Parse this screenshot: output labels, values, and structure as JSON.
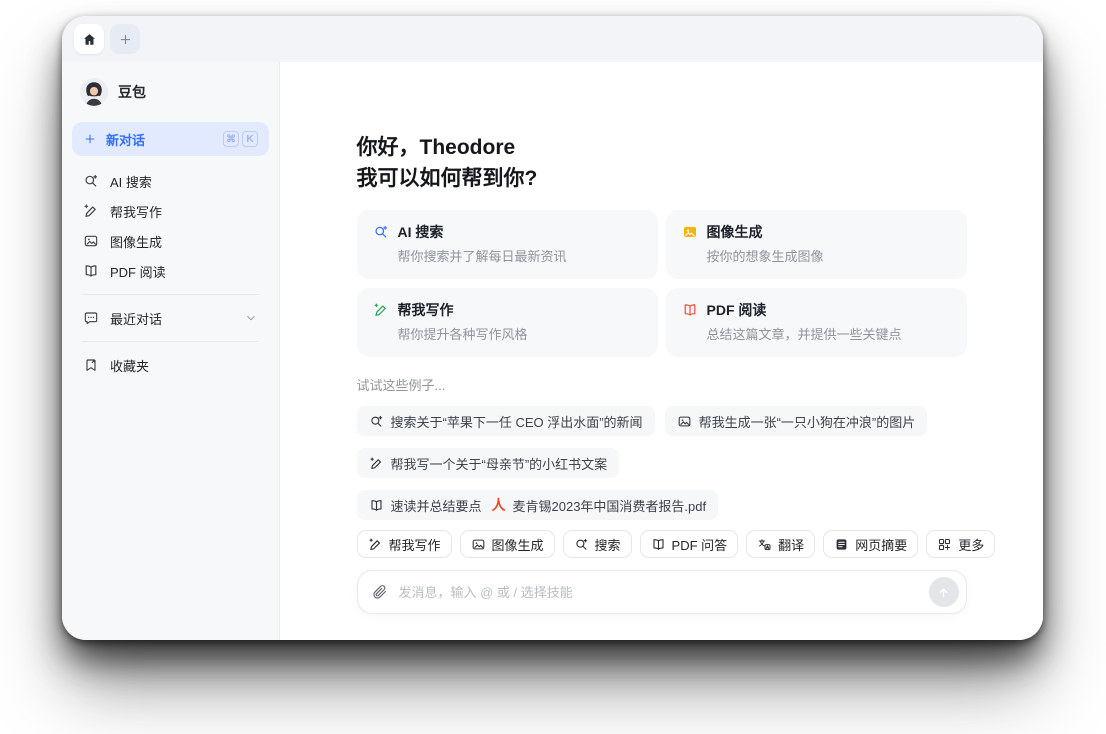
{
  "tabbar": {
    "tabs": [
      {
        "name": "home",
        "icon": "home-icon"
      },
      {
        "name": "new-tab",
        "icon": "plus-icon"
      }
    ]
  },
  "sidebar": {
    "profile": {
      "name": "豆包"
    },
    "new_chat": {
      "label": "新对话",
      "keys": [
        "⌘",
        "K"
      ]
    },
    "items": [
      {
        "icon": "ai-search-icon",
        "label": "AI 搜索"
      },
      {
        "icon": "writing-icon",
        "label": "帮我写作"
      },
      {
        "icon": "image-gen-icon",
        "label": "图像生成"
      },
      {
        "icon": "pdf-read-icon",
        "label": "PDF 阅读"
      }
    ],
    "recent": {
      "icon": "chat-bubble-icon",
      "label": "最近对话"
    },
    "favorites": {
      "icon": "bookmark-icon",
      "label": "收藏夹"
    }
  },
  "main": {
    "greeting_line1": "你好，Theodore",
    "greeting_line2": "我可以如何帮到你?",
    "feature_cards": [
      {
        "icon": "ai-search-icon",
        "color": "#3370ff",
        "title": "AI 搜索",
        "desc": "帮你搜索并了解每日最新资讯"
      },
      {
        "icon": "image-gen-icon",
        "color": "#f2b50f",
        "title": "图像生成",
        "desc": "按你的想象生成图像"
      },
      {
        "icon": "writing-icon",
        "color": "#2aa557",
        "title": "帮我写作",
        "desc": "帮你提升各种写作风格"
      },
      {
        "icon": "pdf-read-icon",
        "color": "#ee4f35",
        "title": "PDF 阅读",
        "desc": "总结这篇文章，并提供一些关键点"
      }
    ],
    "examples_label": "试试这些例子...",
    "example_chips": [
      {
        "icon": "search-icon",
        "text": "搜索关于“苹果下一任 CEO 浮出水面”的新闻"
      },
      {
        "icon": "image-icon",
        "text": "帮我生成一张“一只小狗在冲浪”的图片"
      },
      {
        "icon": "pen-icon",
        "text": "帮我写一个关于“母亲节”的小红书文案"
      },
      {
        "icon": "book-icon",
        "text": "速读并总结要点",
        "attachment": {
          "icon": "pdf-file-icon",
          "glyph": "人",
          "name": "麦肯锡2023年中国消费者报告.pdf"
        }
      }
    ],
    "skill_chips": [
      {
        "icon": "pen-icon",
        "label": "帮我写作"
      },
      {
        "icon": "image-icon",
        "label": "图像生成"
      },
      {
        "icon": "search-icon",
        "label": "搜索"
      },
      {
        "icon": "book-icon",
        "label": "PDF 问答"
      },
      {
        "icon": "translate-icon",
        "label": "翻译"
      },
      {
        "icon": "webpage-icon",
        "label": "网页摘要"
      },
      {
        "icon": "more-icon",
        "label": "更多"
      }
    ],
    "composer": {
      "placeholder": "发消息，输入 @ 或 / 选择技能"
    }
  },
  "colors": {
    "accent": "#3370ff",
    "new_chat_bg": "#e1eaff",
    "sidebar_bg": "#f7f8fa",
    "tabbar_bg": "#f2f4f8",
    "card_bg": "#f7f8fa",
    "search_blue": "#3370ff",
    "image_yellow": "#f2b50f",
    "writing_green": "#2aa557",
    "pdf_red": "#ee4f35",
    "pdf_file_red": "#ef4626",
    "send_disabled": "#e3e5e9"
  }
}
